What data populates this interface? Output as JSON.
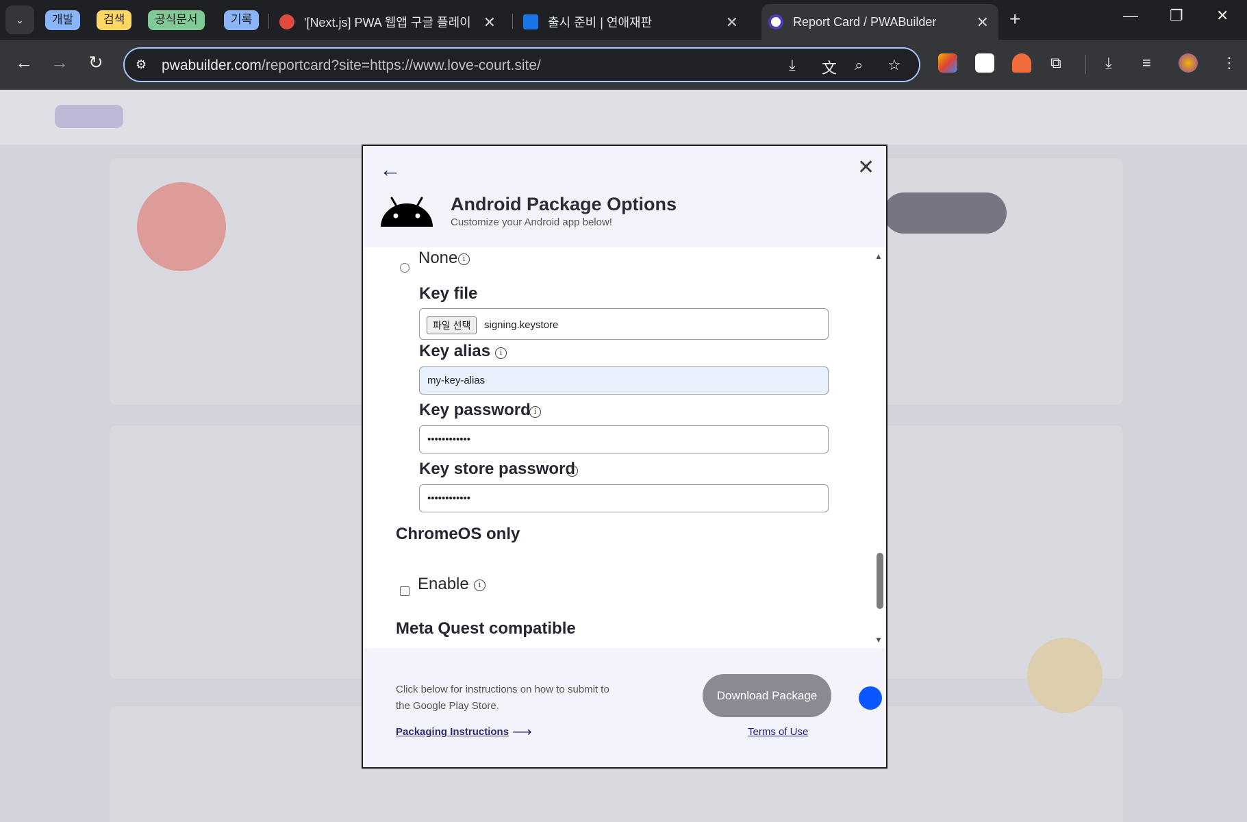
{
  "tabbar": {
    "groups": [
      {
        "label": "개발",
        "color": "#8ab4f8"
      },
      {
        "label": "검색",
        "color": "#fdd663"
      },
      {
        "label": "공식문서",
        "color": "#81c995"
      },
      {
        "label": "기록",
        "color": "#8ab4f8"
      }
    ],
    "tabs": [
      {
        "title": "'[Next.js] PWA 웹앱 구글 플레이",
        "icon": "velog-icon"
      },
      {
        "title": "출시 준비 | 연애재판",
        "icon": "notion-calendar-icon"
      },
      {
        "title": "Report Card / PWABuilder",
        "icon": "pwabuilder-icon",
        "active": true
      }
    ]
  },
  "toolbar": {
    "url_host": "pwabuilder.com",
    "url_path": "/reportcard?site=https://www.love-court.site/"
  },
  "modal": {
    "title": "Android Package Options",
    "subtitle": "Customize your Android app below!",
    "signing_option_none": "None",
    "key_file": {
      "label": "Key file",
      "button": "파일 선택",
      "filename": "signing.keystore"
    },
    "key_alias": {
      "label": "Key alias",
      "value": "my-key-alias"
    },
    "key_password": {
      "label": "Key password",
      "value": "••••••••••••"
    },
    "key_store_password": {
      "label": "Key store password",
      "value": "••••••••••••"
    },
    "chromeos": {
      "heading": "ChromeOS only",
      "enable_label": "Enable"
    },
    "meta_quest": {
      "heading": "Meta Quest compatible"
    },
    "footer": {
      "instructions": "Click below for instructions on how to submit to the Google Play Store.",
      "packaging_link": "Packaging Instructions",
      "download_button": "Download Package",
      "terms_link": "Terms of Use"
    }
  },
  "colors": {
    "accent": "#2e2a73",
    "download_button": "#898a94",
    "omnibox_border": "#a8c7fa"
  }
}
